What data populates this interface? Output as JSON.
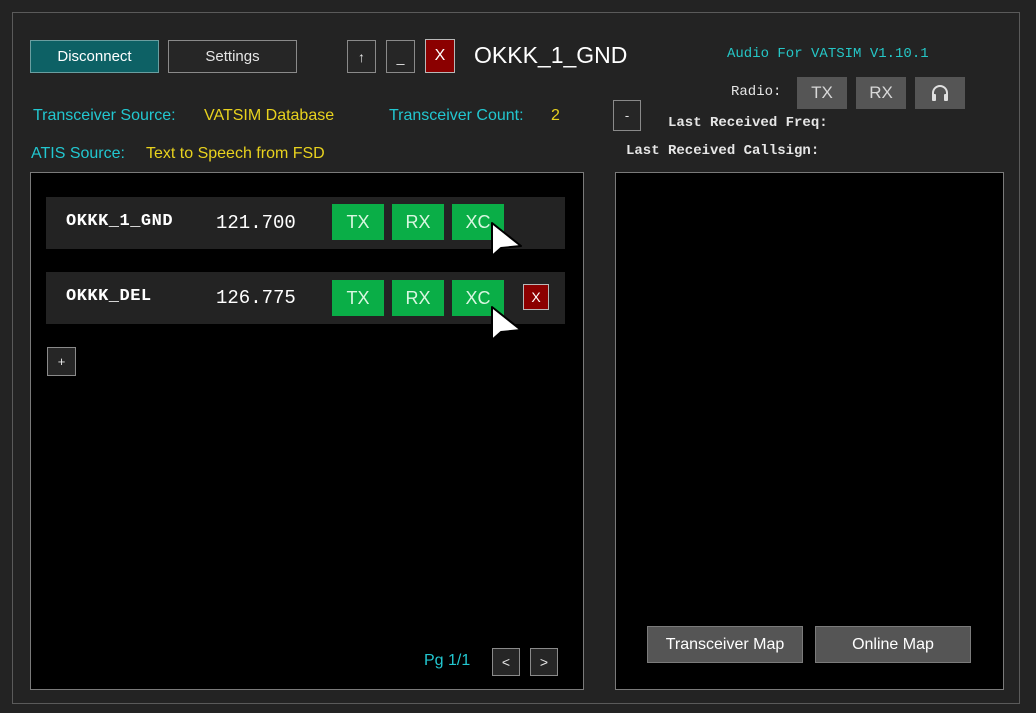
{
  "toolbar": {
    "disconnect_label": "Disconnect",
    "settings_label": "Settings",
    "up_label": "↑",
    "minimize_label": "_",
    "close_label": "X"
  },
  "window": {
    "title": "OKKK_1_GND",
    "version": "Audio For VATSIM V1.10.1"
  },
  "radio": {
    "label": "Radio:",
    "tx_label": "TX",
    "rx_label": "RX",
    "headphones_icon": "headphones-icon"
  },
  "info": {
    "transceiver_source_label": "Transceiver Source:",
    "transceiver_source_value": "VATSIM Database",
    "transceiver_count_label": "Transceiver Count:",
    "transceiver_count_value": "2",
    "atis_source_label": "ATIS Source:",
    "atis_source_value": "Text to Speech from FSD"
  },
  "received": {
    "toggle_label": "-",
    "last_freq_label": "Last Received Freq:",
    "last_callsign_label": "Last Received Callsign:"
  },
  "stations": [
    {
      "callsign": "OKKK_1_GND",
      "freq": "121.700",
      "tx": "TX",
      "rx": "RX",
      "xc": "XC",
      "remove": ""
    },
    {
      "callsign": "OKKK_DEL",
      "freq": "126.775",
      "tx": "TX",
      "rx": "RX",
      "xc": "XC",
      "remove": "X"
    }
  ],
  "add_label": "+",
  "pagination": {
    "label": "Pg 1/1",
    "prev": "<",
    "next": ">"
  },
  "maps": {
    "transceiver_map_label": "Transceiver Map",
    "online_map_label": "Online Map"
  },
  "colors": {
    "accent_teal": "#0d6165",
    "label_cyan": "#22c7d0",
    "value_yellow": "#e8d21e",
    "active_green": "#0aae47",
    "close_red": "#8b0000"
  }
}
